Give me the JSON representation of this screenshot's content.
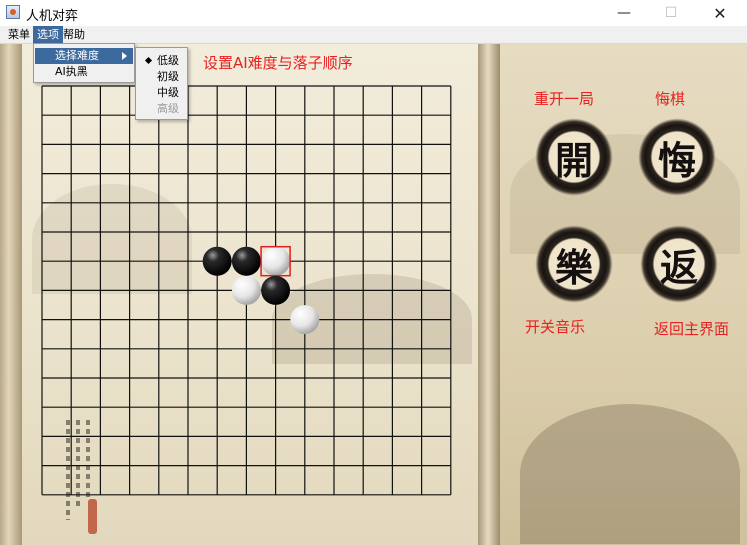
{
  "window": {
    "title": "人机对弈",
    "minimize": "—",
    "maximize": "☐",
    "close": "✕"
  },
  "menubar": {
    "items": [
      {
        "label": "菜单"
      },
      {
        "label": "选项"
      },
      {
        "label": "帮助"
      }
    ]
  },
  "options_menu": {
    "items": [
      {
        "label": "选择难度"
      },
      {
        "label": "AI执黑"
      }
    ]
  },
  "difficulty_menu": {
    "selected": "低级",
    "items": [
      {
        "label": "低级"
      },
      {
        "label": "初级"
      },
      {
        "label": "中级"
      },
      {
        "label": "高级"
      }
    ]
  },
  "hint": "设置AI难度与落子顺序",
  "board": {
    "size": 15,
    "stones": [
      {
        "col": 6,
        "row": 6,
        "color": "black"
      },
      {
        "col": 7,
        "row": 6,
        "color": "black"
      },
      {
        "col": 8,
        "row": 6,
        "color": "white",
        "last_move": true
      },
      {
        "col": 7,
        "row": 7,
        "color": "white"
      },
      {
        "col": 8,
        "row": 7,
        "color": "black"
      },
      {
        "col": 9,
        "row": 8,
        "color": "white"
      }
    ]
  },
  "controls": {
    "restart": {
      "label": "重开一局",
      "glyph": "開"
    },
    "undo": {
      "label": "悔棋",
      "glyph": "悔"
    },
    "music": {
      "label": "开关音乐",
      "glyph": "樂"
    },
    "back": {
      "label": "返回主界面",
      "glyph": "返"
    }
  },
  "colors": {
    "accent_red": "#e82020",
    "menu_highlight": "#3d6a9e"
  }
}
